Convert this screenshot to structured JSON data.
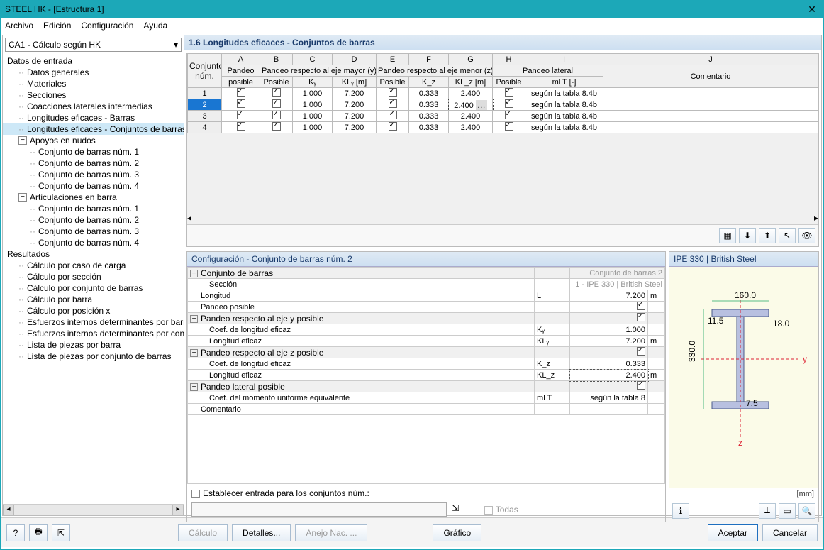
{
  "window": {
    "title": "STEEL HK - [Estructura 1]",
    "close": "✕"
  },
  "menu": {
    "archivo": "Archivo",
    "edicion": "Edición",
    "config": "Configuración",
    "ayuda": "Ayuda"
  },
  "dropdown": {
    "value": "CA1 - Cálculo según HK"
  },
  "tree": {
    "datos": "Datos de entrada",
    "generales": "Datos generales",
    "materiales": "Materiales",
    "secciones": "Secciones",
    "coacciones": "Coacciones laterales intermedias",
    "lef_barras": "Longitudes eficaces - Barras",
    "lef_conj": "Longitudes eficaces - Conjuntos de barras",
    "apoyos": "Apoyos en nudos",
    "cb1": "Conjunto de barras núm. 1",
    "cb2": "Conjunto de barras núm. 2",
    "cb3": "Conjunto de barras núm. 3",
    "cb4": "Conjunto de barras núm. 4",
    "artic": "Articulaciones en barra",
    "resultados": "Resultados",
    "r1": "Cálculo por caso de carga",
    "r2": "Cálculo por sección",
    "r3": "Cálculo por conjunto de barras",
    "r4": "Cálculo por barra",
    "r5": "Cálculo por posición x",
    "r6": "Esfuerzos internos determinantes por barra",
    "r7": "Esfuerzos internos determinantes por conjunto",
    "r8": "Lista de piezas por barra",
    "r9": "Lista de piezas por conjunto de barras"
  },
  "panel_title": "1.6 Longitudes eficaces - Conjuntos de barras",
  "cols": {
    "letters": [
      "A",
      "B",
      "C",
      "D",
      "E",
      "F",
      "G",
      "H",
      "I",
      "J"
    ],
    "conjunto": "Conjunto",
    "num": "núm.",
    "pandeo_pos": "Pandeo",
    "posible": "posible",
    "grp_y": "Pandeo respecto al eje mayor (y)",
    "grp_z": "Pandeo respecto al eje menor (z)",
    "grp_lat": "Pandeo lateral",
    "posible_h": "Posible",
    "ky": "Kᵧ",
    "kly": "KLᵧ [m]",
    "kz": "K_z",
    "klz": "KL_z [m]",
    "mlt": "mLT [-]",
    "comentario": "Comentario"
  },
  "rows": [
    {
      "n": "1",
      "ky": "1.000",
      "kly": "7.200",
      "kz": "0.333",
      "klz": "2.400",
      "mlt": "según la tabla 8.4b"
    },
    {
      "n": "2",
      "ky": "1.000",
      "kly": "7.200",
      "kz": "0.333",
      "klz": "2.400",
      "mlt": "según la tabla 8.4b",
      "sel": true
    },
    {
      "n": "3",
      "ky": "1.000",
      "kly": "7.200",
      "kz": "0.333",
      "klz": "2.400",
      "mlt": "según la tabla 8.4b"
    },
    {
      "n": "4",
      "ky": "1.000",
      "kly": "7.200",
      "kz": "0.333",
      "klz": "2.400",
      "mlt": "según la tabla 8.4b"
    }
  ],
  "config_header": "Configuración - Conjunto de barras núm. 2",
  "props": {
    "conjunto": "Conjunto de barras",
    "conjunto_val": "Conjunto de barras 2",
    "seccion": "Sección",
    "seccion_val": "1 - IPE 330 | British Steel",
    "longitud": "Longitud",
    "L": "L",
    "longitud_val": "7.200",
    "m": "m",
    "pp": "Pandeo posible",
    "py": "Pandeo respecto al eje y posible",
    "coef": "Coef. de longitud eficaz",
    "leff": "Longitud eficaz",
    "ky": "Kᵧ",
    "ky_val": "1.000",
    "kly": "KLᵧ",
    "kly_val": "7.200",
    "pz": "Pandeo respecto al eje z posible",
    "kz": "K_z",
    "kz_val": "0.333",
    "klz": "KL_z",
    "klz_val": "2.400",
    "plat": "Pandeo lateral posible",
    "cmue": "Coef. del momento uniforme equivalente",
    "mlt": "mLT",
    "mlt_val": "según la tabla 8",
    "coment": "Comentario"
  },
  "establish": "Establecer entrada para los conjuntos núm.:",
  "todas": "Todas",
  "preview_title": "IPE 330 | British Steel",
  "dims": {
    "w": "160.0",
    "tf": "11.5",
    "tw": "7.5",
    "r": "18.0",
    "h": "330.0",
    "y": "y",
    "z": "z",
    "mm": "[mm]"
  },
  "footer": {
    "calculo": "Cálculo",
    "detalles": "Detalles...",
    "anejo": "Anejo Nac. ...",
    "grafico": "Gráfico",
    "aceptar": "Aceptar",
    "cancelar": "Cancelar"
  }
}
